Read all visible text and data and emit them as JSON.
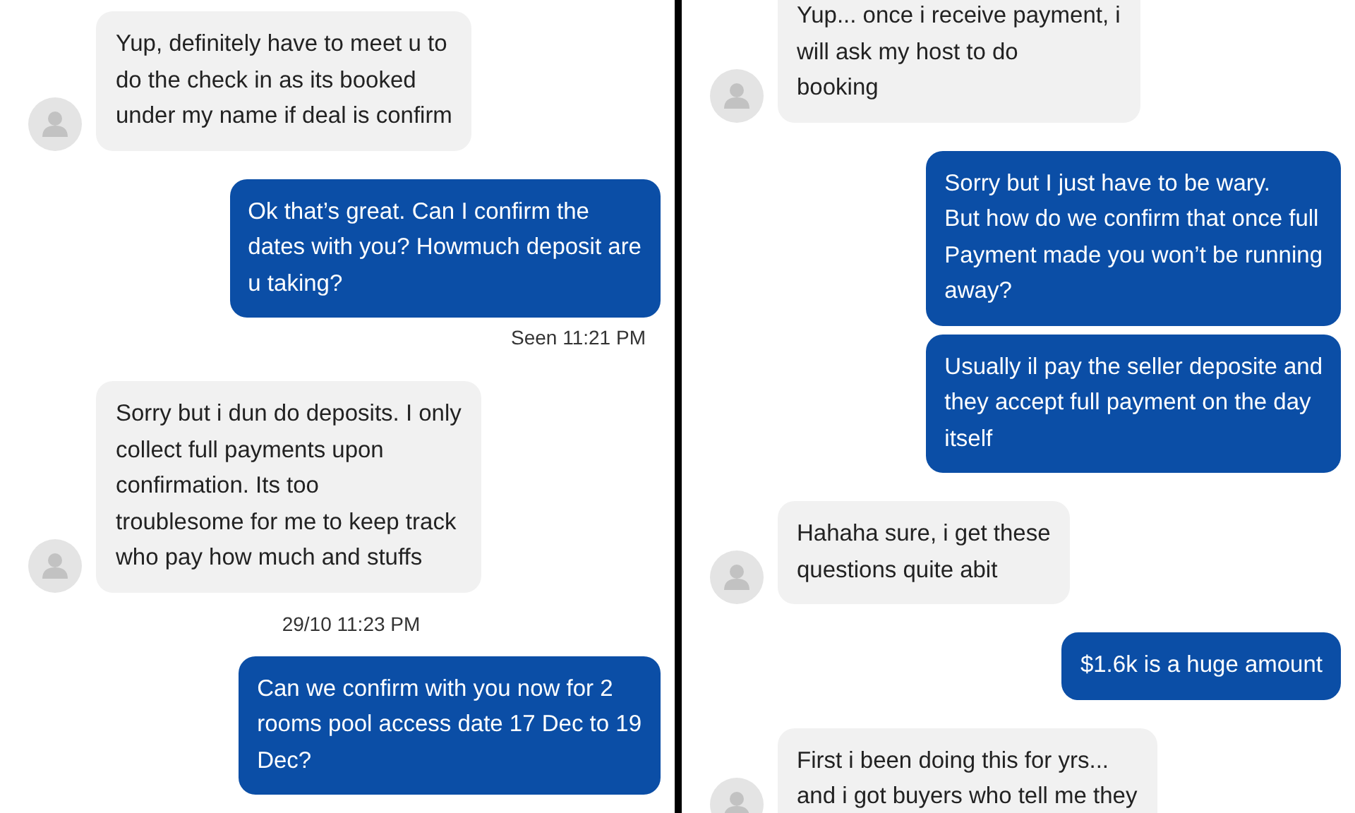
{
  "panels": [
    {
      "messages": [
        {
          "kind": "received",
          "lines": [
            "Yup, definitely have to meet u to",
            "do the check in as its booked",
            "under my name if deal is confirm"
          ]
        },
        {
          "kind": "sent",
          "lines": [
            "Ok that’s great. Can I confirm the",
            "dates with you? Howmuch deposit are",
            "u taking?"
          ]
        },
        {
          "kind": "seen",
          "lines": [
            "Seen 11:21 PM"
          ]
        },
        {
          "kind": "received",
          "lines": [
            "Sorry but i dun do deposits. I only",
            "collect full payments upon",
            "confirmation. Its too",
            "troublesome for me to keep track",
            "who pay how much and stuffs"
          ]
        },
        {
          "kind": "date",
          "lines": [
            "29/10 11:23 PM"
          ]
        },
        {
          "kind": "sent",
          "lines": [
            "Can we confirm with you now for 2",
            "rooms pool access date 17 Dec to 19",
            "Dec?"
          ]
        }
      ]
    },
    {
      "messages": [
        {
          "kind": "received",
          "lines": [
            "Yup... once i receive payment, i",
            "will ask my host to do",
            "booking"
          ]
        },
        {
          "kind": "sent",
          "lines": [
            "Sorry but I just have to be wary.",
            "But how do we confirm that once full",
            "Payment made you won’t be running",
            "away?"
          ]
        },
        {
          "kind": "sent",
          "lines": [
            "Usually il pay the seller deposite and",
            "they accept full payment on the day",
            "itself"
          ]
        },
        {
          "kind": "received",
          "lines": [
            "Hahaha sure, i get these",
            "questions quite abit"
          ]
        },
        {
          "kind": "sent",
          "lines": [
            "$1.6k is a huge amount"
          ]
        },
        {
          "kind": "received",
          "lines": [
            "First i been doing this for yrs...",
            "and i got buyers who tell me they"
          ]
        }
      ]
    }
  ]
}
